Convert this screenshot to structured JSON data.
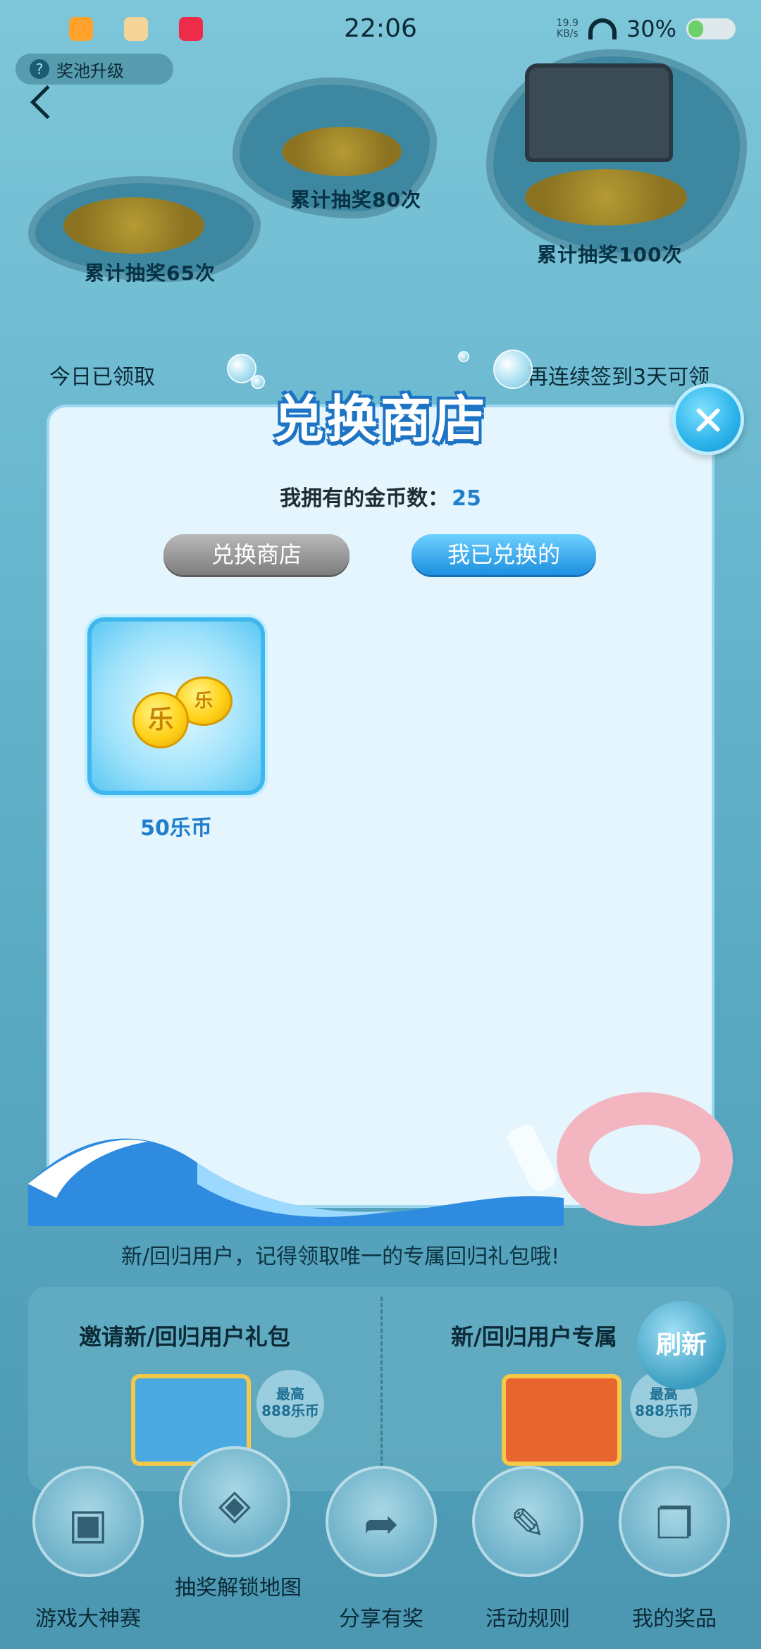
{
  "status_bar": {
    "time": "22:06",
    "net_speed_value": "19.9",
    "net_speed_unit": "KB/s",
    "battery": "30%"
  },
  "background": {
    "pool_upgrade": "奖池升级",
    "milestones": [
      "累计抽奖65次",
      "累计抽奖80次",
      "累计抽奖100次"
    ],
    "claimed_today": "今日已领取",
    "signin_hint": "再连续签到3天可领",
    "invite_line_partial": "新/回归用户，记得领取唯一的专属回归礼包哦!",
    "panel_left_title": "邀请新/回归用户礼包",
    "panel_right_title": "新/回归用户专属",
    "badge_top": "最高",
    "badge_value": "888乐币",
    "refresh_label": "刷新"
  },
  "modal": {
    "title": "兑换商店",
    "coins_label": "我拥有的金币数：",
    "coins_value": "25",
    "tabs": {
      "store": "兑换商店",
      "redeemed": "我已兑换的"
    },
    "items": [
      {
        "label": "50乐币",
        "icon": "coin-stack-icon",
        "glyph": "乐"
      }
    ]
  },
  "bottom_nav": [
    {
      "label": "游戏大神赛",
      "icon": "tv-icon"
    },
    {
      "label": "抽奖解锁地图",
      "icon": "map-icon"
    },
    {
      "label": "分享有奖",
      "icon": "share-icon"
    },
    {
      "label": "活动规则",
      "icon": "book-icon"
    },
    {
      "label": "我的奖品",
      "icon": "gift-icon"
    }
  ],
  "colors": {
    "accent_blue": "#1f7fcc",
    "tab_active": "#1c8fe0",
    "tab_inactive": "#7d7d7d",
    "modal_bg": "#e4f5fd"
  }
}
